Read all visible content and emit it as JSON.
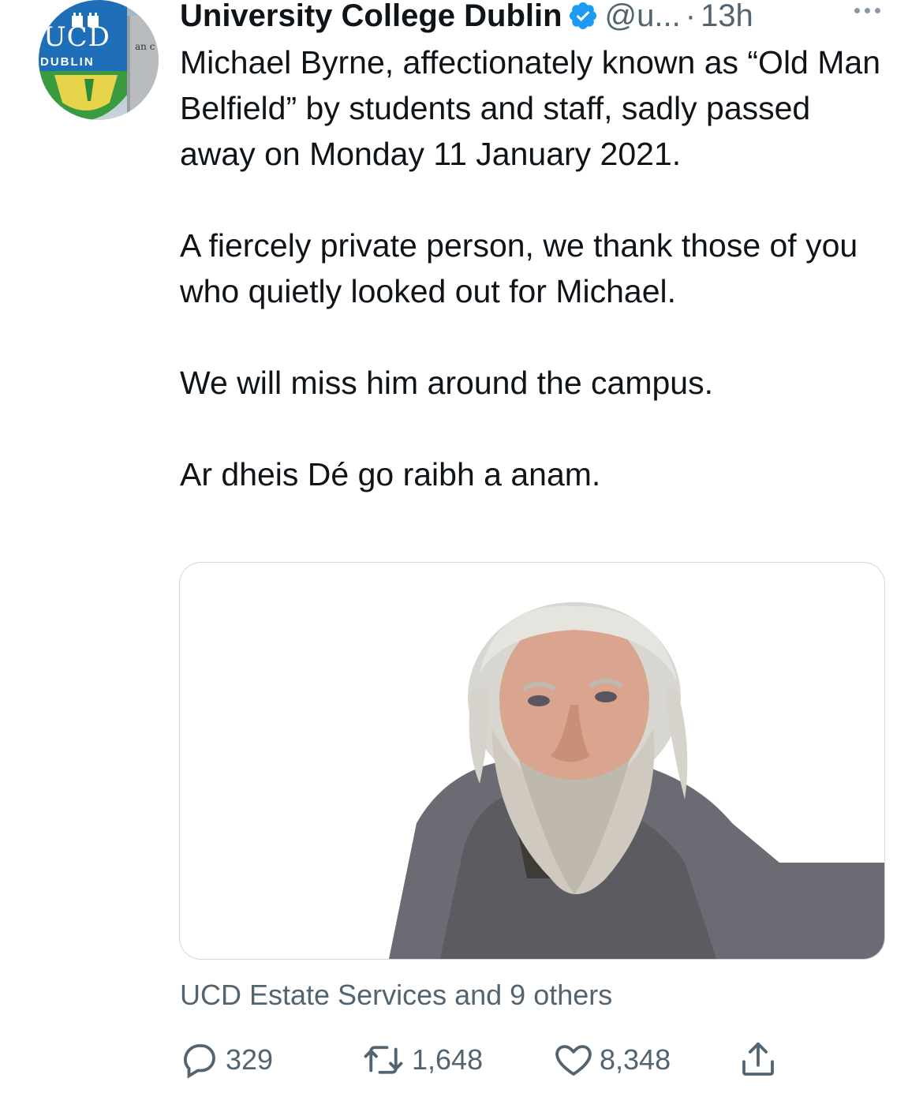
{
  "account": {
    "display_name": "University College Dublin",
    "handle": "@u...",
    "separator": "·",
    "time": "13h",
    "avatar_text_main": "UCD",
    "avatar_text_sub": "DUBLIN",
    "avatar_sign_text": "an c"
  },
  "tweet": {
    "paragraphs": [
      "Michael Byrne, affectionately known as “Old Man Belfield” by students and staff, sadly passed away on Monday 11 January 2021.",
      "A fiercely private person, we thank those of you who quietly looked out for Michael.",
      "We will miss him around the campus.",
      "Ar dheis Dé go raibh a anam."
    ]
  },
  "media": {
    "description_icon": "photo"
  },
  "tagged": {
    "text": "UCD Estate Services and 9 others"
  },
  "actions": {
    "replies": "329",
    "retweets": "1,648",
    "likes": "8,348"
  },
  "colors": {
    "text": "#0f1419",
    "secondary": "#536471",
    "verified": "#1d9bf0",
    "border": "#cfd9de"
  }
}
